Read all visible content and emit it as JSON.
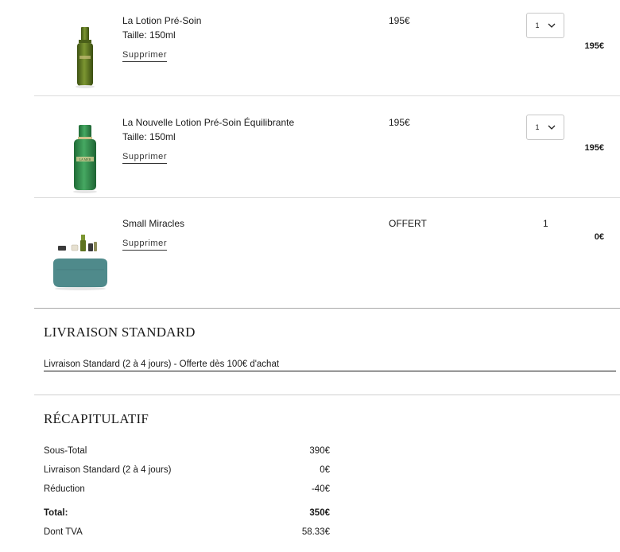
{
  "cart": {
    "items": [
      {
        "name": "La Lotion Pré-Soin",
        "size": "Taille: 150ml",
        "remove": "Supprimer",
        "price": "195€",
        "quantity": "1",
        "total": "195€"
      },
      {
        "name": "La Nouvelle Lotion Pré-Soin Équilibrante",
        "size": "Taille: 150ml",
        "remove": "Supprimer",
        "price": "195€",
        "quantity": "1",
        "total": "195€"
      },
      {
        "name": "Small Miracles",
        "remove": "Supprimer",
        "price": "OFFERT",
        "quantity": "1",
        "total": "0€"
      }
    ],
    "bottle_logo": "LA MER",
    "colors": {
      "bottle_olive": "#5d7320",
      "bottle_green": "#2f8b4a",
      "pouch_teal": "#4f8a8b"
    }
  },
  "shipping": {
    "title": "LIVRAISON STANDARD",
    "option": "Livraison Standard (2 à 4 jours) - Offerte dès 100€ d'achat"
  },
  "summary": {
    "title": "RÉCAPITULATIF",
    "rows": [
      {
        "label": "Sous-Total",
        "value": "390€"
      },
      {
        "label": "Livraison Standard (2 à 4 jours)",
        "value": "0€"
      },
      {
        "label": "Réduction",
        "value": "-40€"
      },
      {
        "label": "Total:",
        "value": "350€"
      },
      {
        "label": "Dont TVA",
        "value": "58.33€"
      }
    ]
  }
}
